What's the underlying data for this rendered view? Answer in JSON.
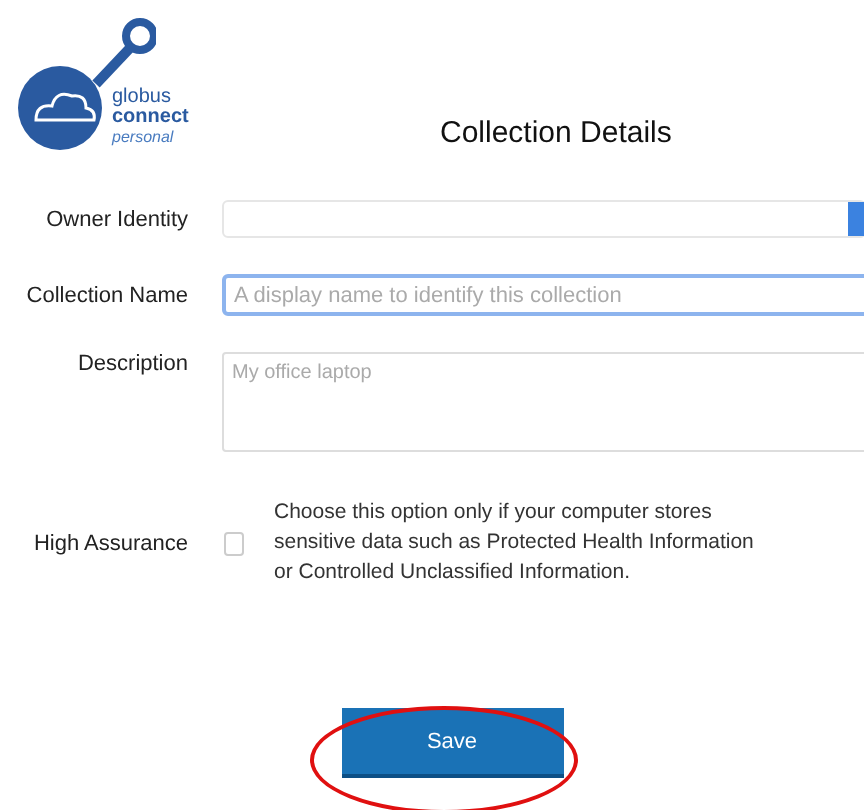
{
  "logo": {
    "lines": [
      "globus",
      "connect",
      "personal"
    ]
  },
  "title": "Collection Details",
  "fields": [
    {
      "kind": "select",
      "label": "Owner Identity"
    },
    {
      "kind": "text",
      "label": "Collection Name",
      "placeholder": "A display name to identify this collection",
      "focused": true
    },
    {
      "kind": "textarea",
      "label": "Description",
      "placeholder": "My office laptop",
      "focused": false
    },
    {
      "kind": "checkbox",
      "label": "High Assurance",
      "checked": false,
      "note": "Choose this option only if your computer stores sensitive data such as Protected Health Information or Controlled Unclassified Information."
    }
  ],
  "save_button": {
    "label": "Save",
    "highlighted": true
  }
}
